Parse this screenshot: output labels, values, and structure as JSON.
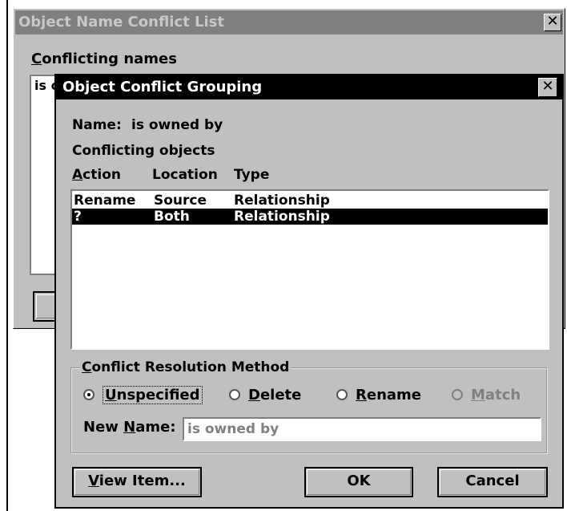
{
  "back_window": {
    "title": "Object Name Conflict List",
    "close_glyph": "✕",
    "conflicting_label": "Conflicting names",
    "list_item": "is o"
  },
  "dialog": {
    "title": "Object Conflict Grouping",
    "close_glyph": "✕",
    "name_label": "Name:",
    "name_value": "is owned by",
    "conflicting_objects_label": "Conflicting objects",
    "columns": [
      "Action",
      "Location",
      "Type"
    ],
    "rows": [
      {
        "action": "Rename",
        "location": "Source",
        "type": "Relationship",
        "selected": false
      },
      {
        "action": "?",
        "location": "Both",
        "type": "Relationship",
        "selected": true
      }
    ],
    "resolution": {
      "legend": "Conflict Resolution Method",
      "options": [
        "Unspecified",
        "Delete",
        "Rename",
        "Match"
      ],
      "selected": "Unspecified",
      "new_name_label": "New Name:",
      "new_name_value": "is owned by"
    },
    "buttons": {
      "view_item": "View Item...",
      "ok": "OK",
      "cancel": "Cancel"
    }
  }
}
